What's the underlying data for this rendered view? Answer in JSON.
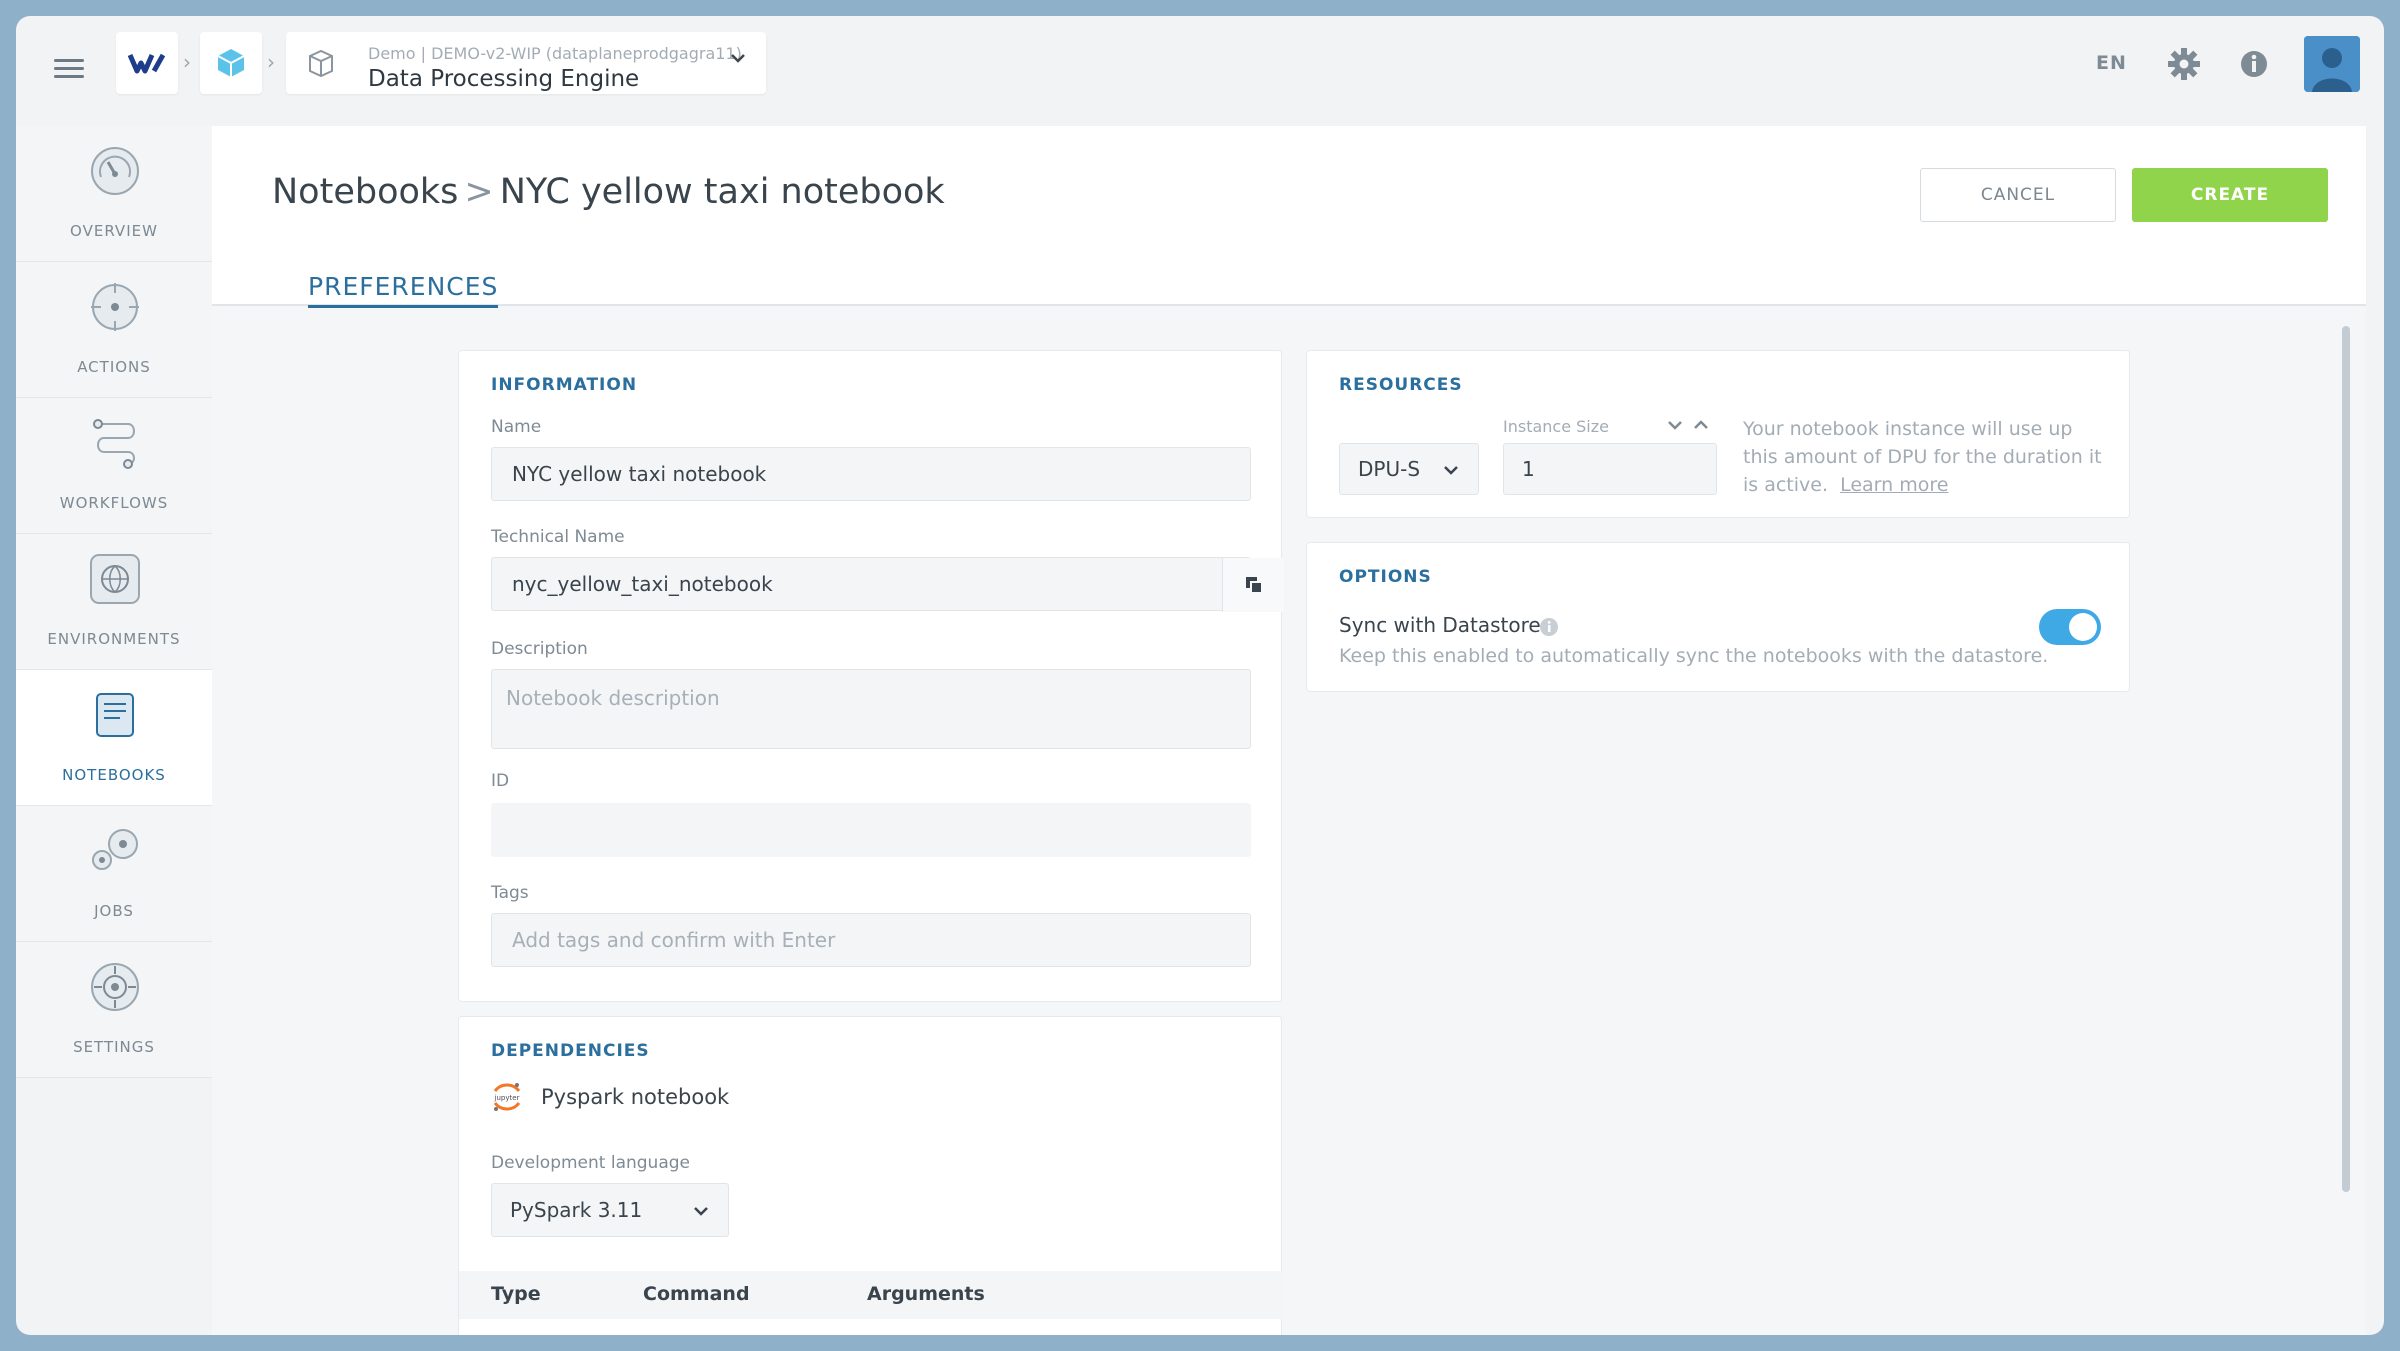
{
  "topbar": {
    "engine_subtitle": "Demo | DEMO-v2-WIP (dataplaneprodgagra11)",
    "engine_title": "Data Processing Engine",
    "language": "EN"
  },
  "sidebar": {
    "items": [
      {
        "label": "OVERVIEW",
        "icon": "gauge-icon"
      },
      {
        "label": "ACTIONS",
        "icon": "target-icon"
      },
      {
        "label": "WORKFLOWS",
        "icon": "workflow-icon"
      },
      {
        "label": "ENVIRONMENTS",
        "icon": "environment-icon"
      },
      {
        "label": "NOTEBOOKS",
        "icon": "notebook-icon",
        "active": true
      },
      {
        "label": "JOBS",
        "icon": "jobs-icon"
      },
      {
        "label": "SETTINGS",
        "icon": "settings-icon"
      }
    ]
  },
  "header": {
    "breadcrumb_root": "Notebooks",
    "breadcrumb_separator": ">",
    "breadcrumb_current": "NYC yellow taxi notebook",
    "cancel_label": "CANCEL",
    "create_label": "CREATE",
    "tab_preferences": "PREFERENCES"
  },
  "information": {
    "title": "INFORMATION",
    "name_label": "Name",
    "name_value": "NYC yellow taxi notebook",
    "technical_name_label": "Technical Name",
    "technical_name_value": "nyc_yellow_taxi_notebook",
    "description_label": "Description",
    "description_placeholder": "Notebook description",
    "id_label": "ID",
    "id_value": "",
    "tags_label": "Tags",
    "tags_placeholder": "Add tags and confirm with Enter"
  },
  "dependencies": {
    "title": "DEPENDENCIES",
    "dependency_name": "Pyspark notebook",
    "dev_language_label": "Development language",
    "dev_language_value": "PySpark 3.11",
    "table_columns": [
      "Type",
      "Command",
      "Arguments"
    ]
  },
  "resources": {
    "title": "RESOURCES",
    "dpu_type": "DPU-S",
    "instance_size_label": "Instance Size",
    "instance_size_value": "1",
    "help_text": "Your notebook instance will use up this amount of DPU for the duration it is active.",
    "learn_more": "Learn more"
  },
  "options": {
    "title": "OPTIONS",
    "sync_label": "Sync with Datastore",
    "sync_help": "Keep this enabled to automatically sync the notebooks with the datastore.",
    "sync_enabled": true
  },
  "colors": {
    "accent": "#2b6f9e",
    "create_button": "#8fd44a",
    "toggle_on": "#3fa9e6"
  }
}
